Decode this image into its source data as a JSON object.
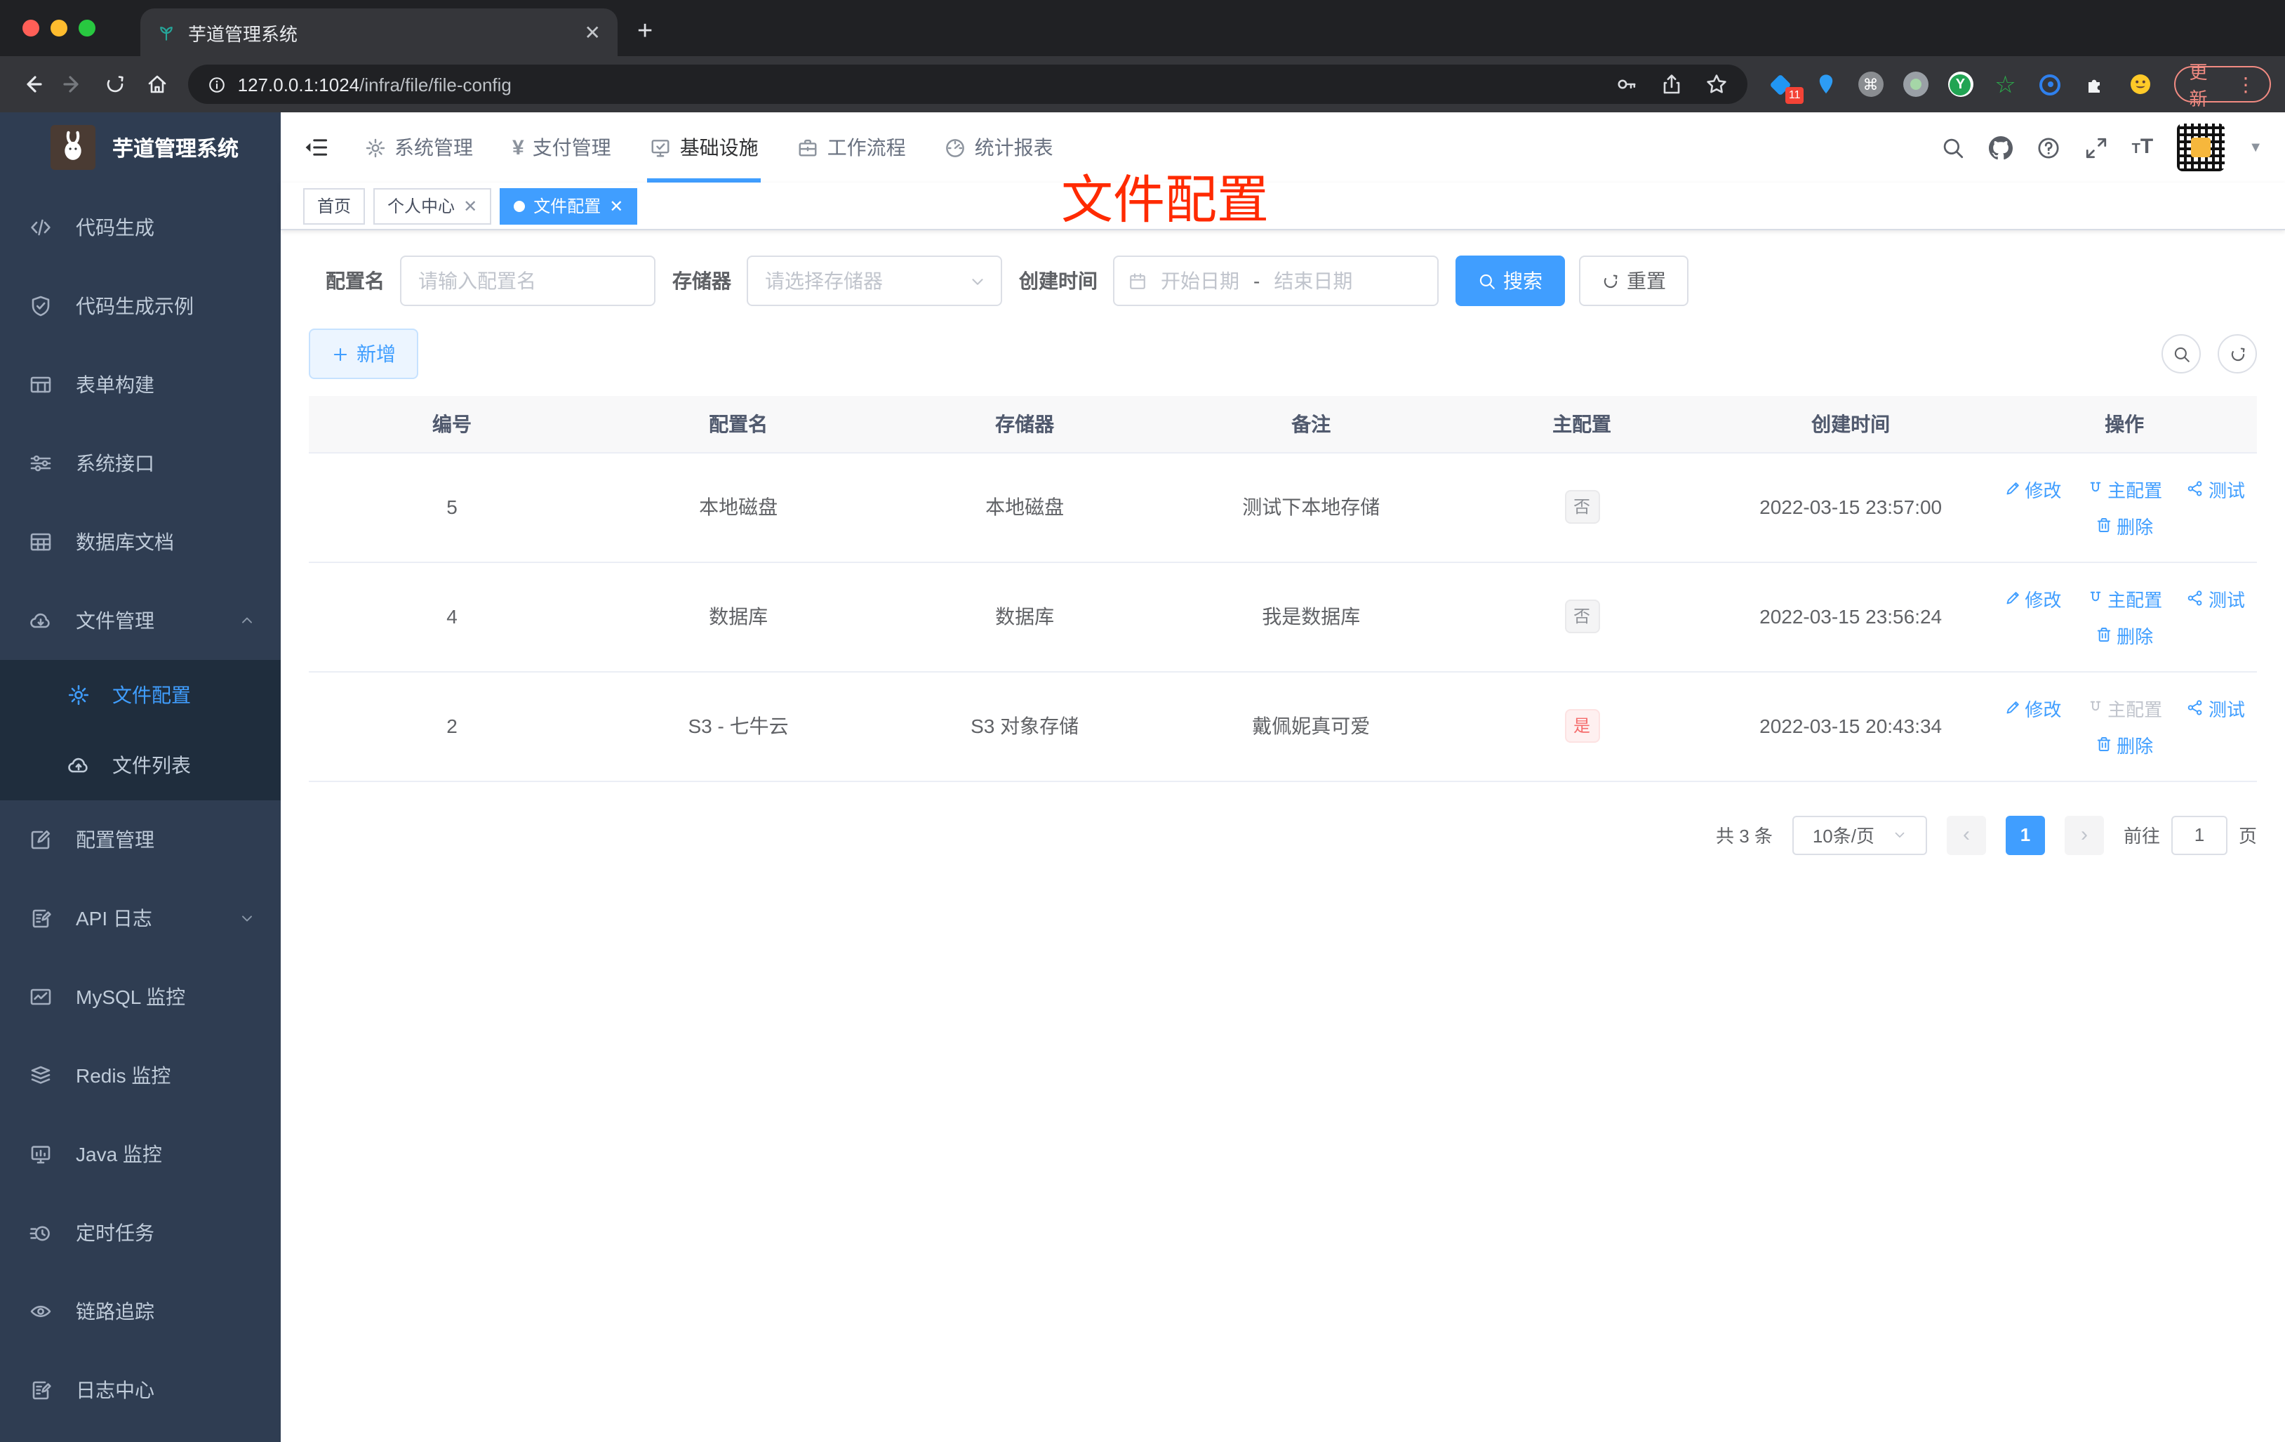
{
  "browser": {
    "tab_title": "芋道管理系统",
    "url_host": "127.0.0.1:1024",
    "url_path": "/infra/file/file-config",
    "extension_badge": "11",
    "update_label": "更新"
  },
  "sidebar": {
    "logo_title": "芋道管理系统",
    "items": [
      {
        "label": "代码生成",
        "icon": "code-icon"
      },
      {
        "label": "代码生成示例",
        "icon": "shield-icon"
      },
      {
        "label": "表单构建",
        "icon": "form-icon"
      },
      {
        "label": "系统接口",
        "icon": "sliders-icon"
      },
      {
        "label": "数据库文档",
        "icon": "grid-icon"
      },
      {
        "label": "文件管理",
        "icon": "cloud-download-icon",
        "expanded": true
      },
      {
        "label": "配置管理",
        "icon": "edit-icon"
      },
      {
        "label": "API 日志",
        "icon": "log-icon",
        "collapsed": true
      },
      {
        "label": "MySQL 监控",
        "icon": "chart-icon"
      },
      {
        "label": "Redis 监控",
        "icon": "layers-icon"
      },
      {
        "label": "Java 监控",
        "icon": "monitor-icon"
      },
      {
        "label": "定时任务",
        "icon": "timer-icon"
      },
      {
        "label": "链路追踪",
        "icon": "eye-icon"
      },
      {
        "label": "日志中心",
        "icon": "log-icon"
      }
    ],
    "submenu": [
      {
        "label": "文件配置",
        "icon": "gear-icon",
        "active": true
      },
      {
        "label": "文件列表",
        "icon": "cloud-upload-icon"
      }
    ]
  },
  "topnav": {
    "items": [
      {
        "label": "系统管理"
      },
      {
        "label": "支付管理"
      },
      {
        "label": "基础设施",
        "active": true
      },
      {
        "label": "工作流程"
      },
      {
        "label": "统计报表"
      }
    ]
  },
  "header_tabs": [
    {
      "label": "首页"
    },
    {
      "label": "个人中心",
      "closable": true
    },
    {
      "label": "文件配置",
      "closable": true,
      "active": true
    }
  ],
  "annotation": "文件配置",
  "filters": {
    "name_label": "配置名",
    "name_placeholder": "请输入配置名",
    "storage_label": "存储器",
    "storage_placeholder": "请选择存储器",
    "date_label": "创建时间",
    "date_start": "开始日期",
    "date_sep": "-",
    "date_end": "结束日期",
    "search_label": "搜索",
    "reset_label": "重置"
  },
  "toolbar": {
    "add_label": "新增"
  },
  "table": {
    "columns": [
      "编号",
      "配置名",
      "存储器",
      "备注",
      "主配置",
      "创建时间",
      "操作"
    ],
    "action_labels": {
      "edit": "修改",
      "master": "主配置",
      "test": "测试",
      "del": "删除"
    },
    "rows": [
      {
        "id": "5",
        "name": "本地磁盘",
        "storage": "本地磁盘",
        "remark": "测试下本地存储",
        "master": "否",
        "created": "2022-03-15 23:57:00"
      },
      {
        "id": "4",
        "name": "数据库",
        "storage": "数据库",
        "remark": "我是数据库",
        "master": "否",
        "created": "2022-03-15 23:56:24"
      },
      {
        "id": "2",
        "name": "S3 - 七牛云",
        "storage": "S3 对象存储",
        "remark": "戴佩妮真可爱",
        "master": "是",
        "created": "2022-03-15 20:43:34"
      }
    ]
  },
  "pagination": {
    "total": "共 3 条",
    "page_size": "10条/页",
    "page": "1",
    "goto_label": "前往",
    "goto_value": "1",
    "goto_suffix": "页"
  },
  "colors": {
    "accent": "#409eff",
    "danger": "#f56c6c",
    "annotation_red": "#ff2a00",
    "sidebar_bg": "#2f3d52"
  }
}
